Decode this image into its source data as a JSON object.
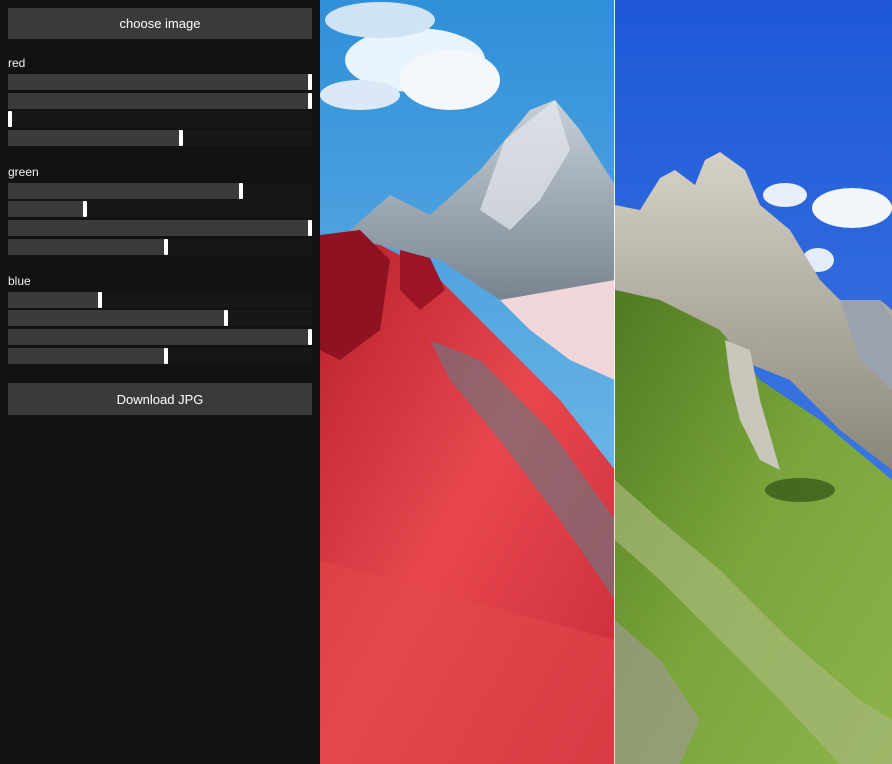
{
  "controls": {
    "choose_label": "choose image",
    "download_label": "Download JPG",
    "groups": [
      {
        "label": "red",
        "values": [
          1.0,
          1.0,
          0.0,
          0.57
        ]
      },
      {
        "label": "green",
        "values": [
          0.77,
          0.25,
          1.0,
          0.52
        ]
      },
      {
        "label": "blue",
        "values": [
          0.3,
          0.72,
          1.0,
          0.52
        ]
      }
    ]
  },
  "viewer": {
    "split_fraction": 0.517,
    "left_image": "processed-red-tinted-mountain",
    "right_image": "original-green-mountain"
  },
  "colors": {
    "panel_bg": "#121212",
    "button_bg": "#3a3a3a",
    "slider_fill": "#3b3b3b",
    "slider_track": "#171717",
    "thumb": "#ffffff"
  }
}
